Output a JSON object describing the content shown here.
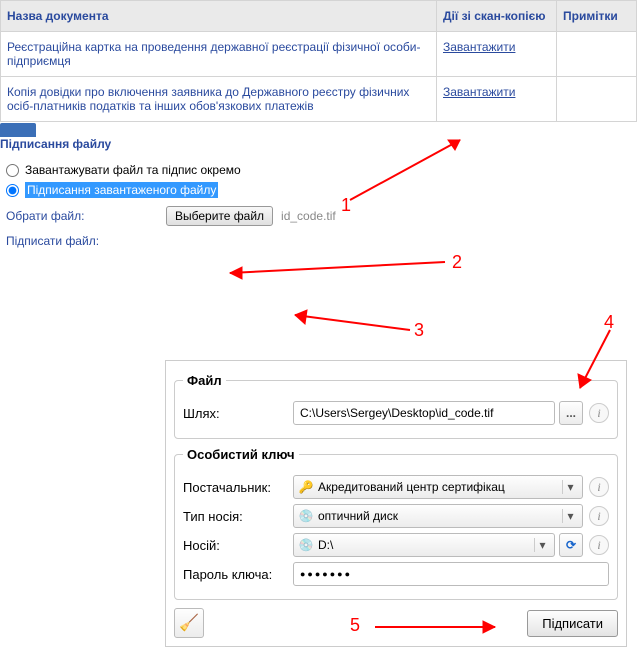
{
  "table": {
    "headers": {
      "name": "Назва документа",
      "action": "Дії зі скан-копією",
      "notes": "Примітки"
    },
    "rows": [
      {
        "name": "Реєстраційна картка на проведення державної реєстрації фізичної особи-підприємця",
        "action": "Завантажити",
        "notes": ""
      },
      {
        "name": "Копія довідки про включення заявника до Державного реєстру фізичних осіб-платників податків та інших обов'язкових платежів",
        "action": "Завантажити",
        "notes": ""
      }
    ]
  },
  "section_title": "Підписання файлу",
  "radios": {
    "separate": "Завантажувати файл та підпис окремо",
    "sign_loaded": "Підписання завантаженого файлу"
  },
  "file_select": {
    "label": "Обрати файл:",
    "button": "Выберите файл",
    "filename": "id_code.tif"
  },
  "sign_label": "Підписати файл:",
  "panel": {
    "file_legend": "Файл",
    "path_label": "Шлях:",
    "path_value": "C:\\Users\\Sergey\\Desktop\\id_code.tif",
    "browse": "...",
    "key_legend": "Особистий ключ",
    "provider_label": "Постачальник:",
    "provider_value": "Акредитований центр сертифікац",
    "media_type_label": "Тип носія:",
    "media_type_value": "оптичний диск",
    "media_label": "Носій:",
    "media_value": "D:\\",
    "password_label": "Пароль ключа:",
    "password_value": "●●●●●●●",
    "sign_button": "Підписати"
  },
  "annotations": {
    "n1": "1",
    "n2": "2",
    "n3": "3",
    "n4": "4",
    "n5": "5"
  }
}
